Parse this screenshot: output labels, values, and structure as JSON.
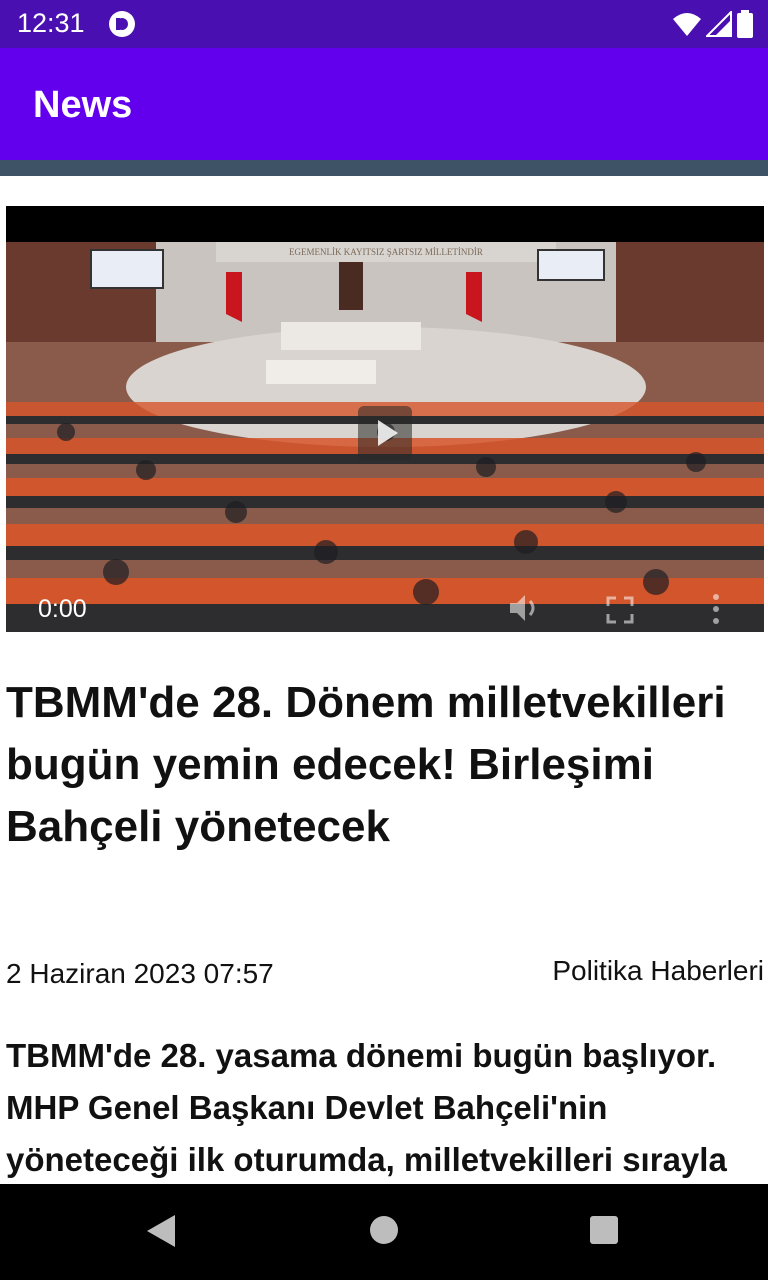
{
  "status_bar": {
    "time": "12:31",
    "icons": [
      "app-notification-icon",
      "wifi-icon",
      "signal-icon",
      "battery-icon"
    ]
  },
  "app_bar": {
    "title": "News"
  },
  "video": {
    "current_time": "0:00",
    "banner_text": "EGEMENLİK KAYITSIZ ŞARTSIZ MİLLETİNDİR",
    "controls": [
      "play-icon",
      "volume-icon",
      "fullscreen-icon",
      "more-vert-icon"
    ]
  },
  "article": {
    "title": "TBMM'de 28. Dönem milletvekilleri bugün yemin edecek! Birleşimi Bahçeli yönetecek",
    "date": "2 Haziran 2023 07:57",
    "category": "Politika Haberleri",
    "summary": "TBMM'de 28. yasama dönemi bugün başlıyor. MHP Genel Başkanı Devlet Bahçeli'nin yöneteceği ilk oturumda, milletvekilleri sırayla"
  },
  "nav_bar": {
    "buttons": [
      "back-icon",
      "home-icon",
      "recents-icon"
    ]
  },
  "colors": {
    "status_bar": "#4a0fb0",
    "app_bar": "#6200ee",
    "divider": "#3f5366",
    "nav_bar": "#000000"
  }
}
